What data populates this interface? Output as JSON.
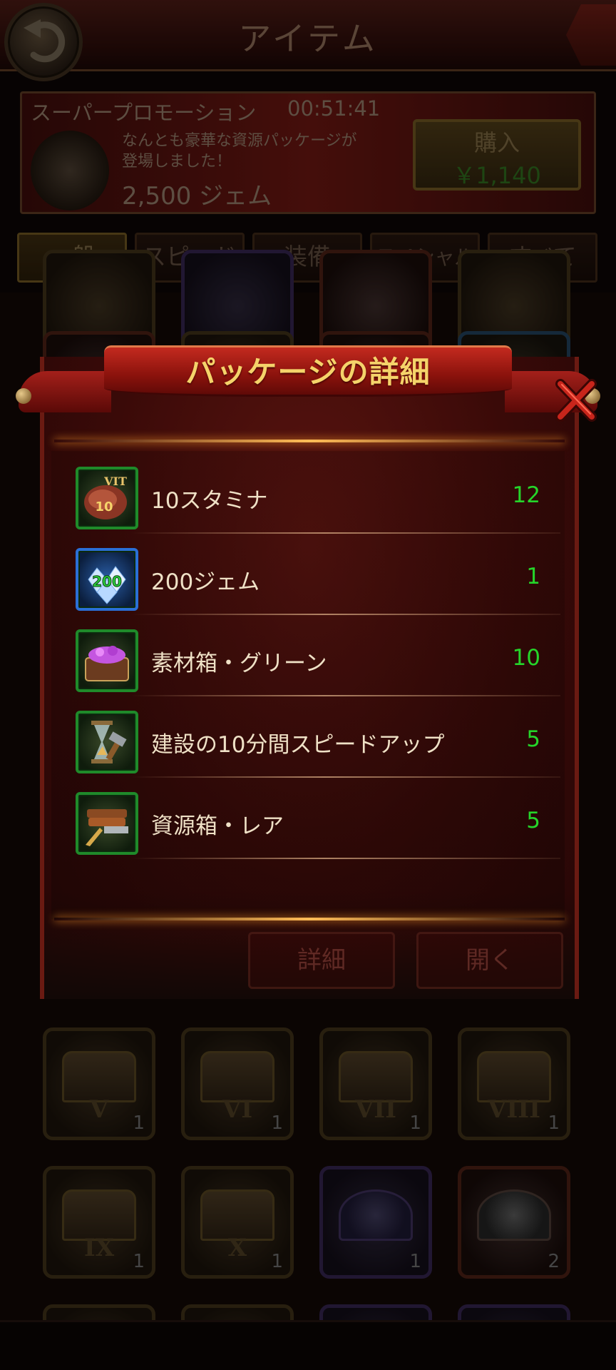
{
  "header": {
    "title": "アイテム"
  },
  "promo": {
    "title": "スーパープロモーション",
    "timer": "00:51:41",
    "desc_line1": "なんとも豪華な資源パッケージが",
    "desc_line2": "登場しました！",
    "amount": "2,500 ジェム",
    "buy_label": "購入",
    "buy_price": "￥1,140"
  },
  "tabs": [
    {
      "label": "一般",
      "active": true
    },
    {
      "label": "スピード",
      "active": false
    },
    {
      "label": "装備",
      "active": false
    },
    {
      "label": "スペシャル",
      "active": false
    },
    {
      "label": "すべて",
      "active": false
    }
  ],
  "grid": {
    "row1": [
      {
        "roman": "V",
        "count": "1"
      },
      {
        "roman": "VI",
        "count": "1"
      },
      {
        "roman": "VII",
        "count": "1"
      },
      {
        "roman": "VIII",
        "count": "1"
      }
    ],
    "row2": [
      {
        "roman": "IX",
        "count": "1"
      },
      {
        "roman": "X",
        "count": "1"
      },
      {
        "roman": "",
        "count": "1"
      },
      {
        "roman": "",
        "count": "2"
      }
    ]
  },
  "modal": {
    "title": "パッケージの詳細",
    "items": [
      {
        "name": "10スタミナ",
        "qty": "12",
        "icon": "stamina-meat-icon",
        "badge_top": "VIT",
        "badge": "10"
      },
      {
        "name": "200ジェム",
        "qty": "1",
        "icon": "gem-pile-icon",
        "badge": "200"
      },
      {
        "name": "素材箱・グリーン",
        "qty": "10",
        "icon": "material-chest-icon"
      },
      {
        "name": "建設の10分間スピードアップ",
        "qty": "5",
        "icon": "hourglass-hammer-icon"
      },
      {
        "name": "資源箱・レア",
        "qty": "5",
        "icon": "resource-chest-icon"
      }
    ],
    "detail_button": "詳細",
    "open_button": "開く"
  },
  "colors": {
    "quantity": "#25d52a",
    "title_gold": "#f5d36a",
    "frame_green": "#1f8a2a",
    "frame_blue": "#2a6fd6"
  }
}
